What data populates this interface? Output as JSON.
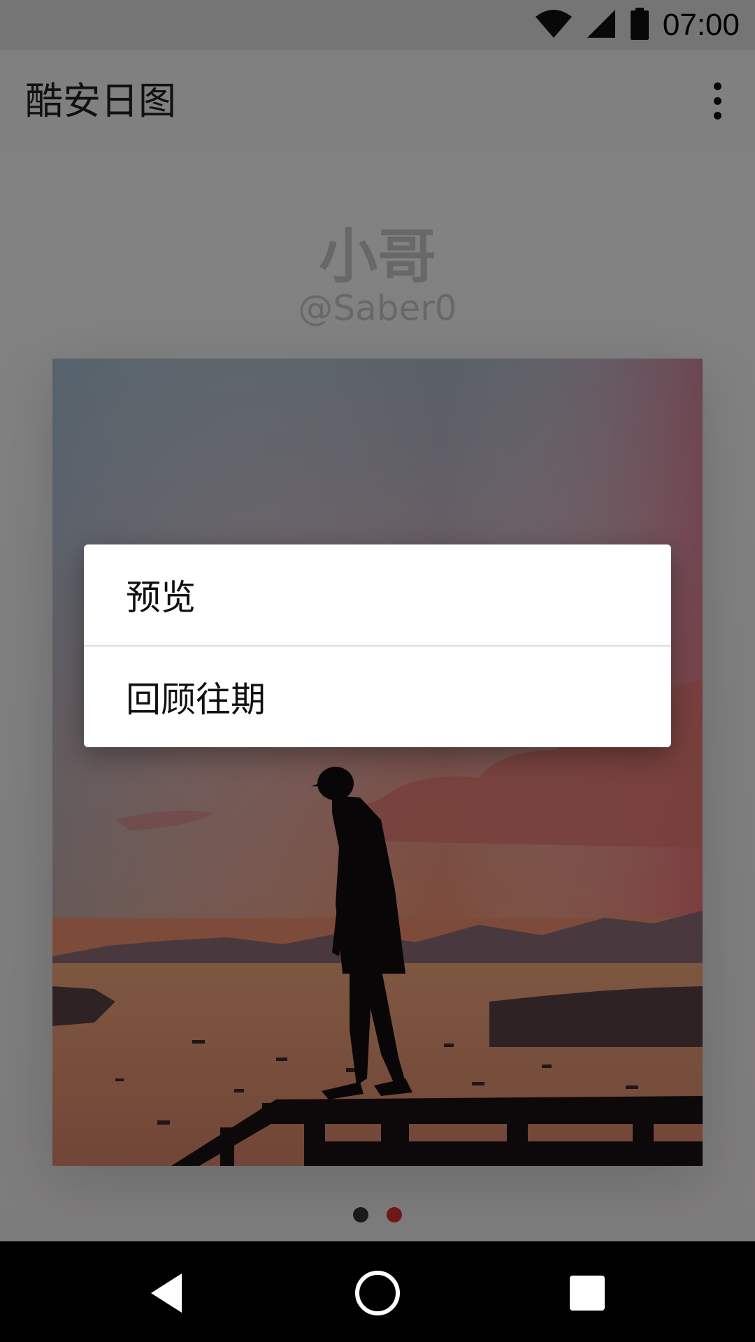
{
  "status_bar": {
    "time": "07:00",
    "icons": [
      "wifi-icon",
      "cell-signal-icon",
      "battery-icon"
    ]
  },
  "toolbar": {
    "title": "酷安日图",
    "overflow_icon": "more-vert-icon"
  },
  "content": {
    "author_name": "小哥",
    "author_handle": "@Saber0",
    "pager": {
      "total": 2,
      "active_index": 1,
      "active_color": "#d32f2f",
      "inactive_color": "#333333"
    }
  },
  "dialog": {
    "items": [
      "预览",
      "回顾往期"
    ]
  },
  "nav_bar": {
    "icons": [
      "back-icon",
      "home-icon",
      "recents-icon"
    ]
  },
  "colors": {
    "scrim": "rgba(0,0,0,0.48)",
    "dialog_bg": "#ffffff"
  }
}
